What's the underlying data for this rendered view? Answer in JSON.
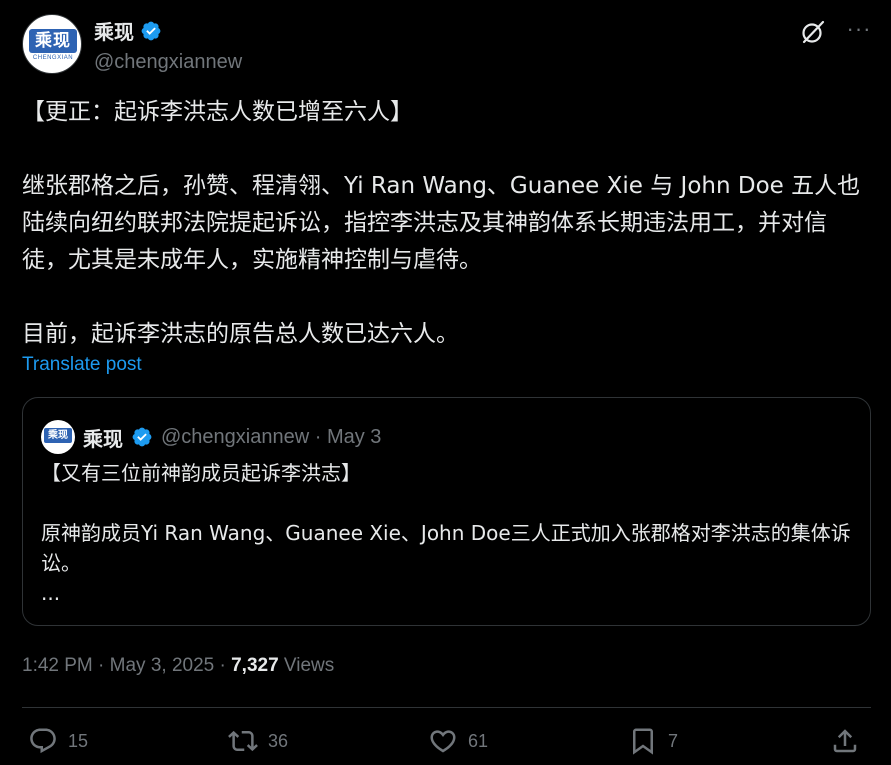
{
  "author": {
    "display_name": "乘现",
    "handle": "@chengxiannew",
    "avatar_logo_text": "乘现",
    "avatar_logo_sub": "CHENGXIAN"
  },
  "post": {
    "text": "【更正：起诉李洪志人数已增至六人】\n\n继张郡格之后，孙赞、程清翎、Yi Ran Wang、Guanee Xie 与 John Doe 五人也陆续向纽约联邦法院提起诉讼，指控李洪志及其神韵体系长期违法用工，并对信徒，尤其是未成年人，实施精神控制与虐待。\n\n目前，起诉李洪志的原告总人数已达六人。",
    "translate_label": "Translate post"
  },
  "quote": {
    "display_name": "乘现",
    "handle_date": "@chengxiannew · May 3",
    "text": "【又有三位前神韵成员起诉李洪志】\n\n原神韵成员Yi Ran Wang、Guanee Xie、John Doe三人正式加入张郡格对李洪志的集体诉讼。\n..."
  },
  "meta": {
    "time_date": "1:42 PM · May 3, 2025 · ",
    "views_count": "7,327",
    "views_label": " Views"
  },
  "actions": {
    "replies": "15",
    "reposts": "36",
    "likes": "61",
    "bookmarks": "7"
  },
  "colors": {
    "background": "#000000",
    "text": "#e7e9ea",
    "secondary": "#71767b",
    "accent": "#1d9bf0",
    "border": "#2f3336"
  },
  "icons": [
    "verified-badge-icon",
    "grok-icon",
    "more-icon",
    "reply-icon",
    "repost-icon",
    "like-icon",
    "bookmark-icon",
    "share-icon"
  ]
}
